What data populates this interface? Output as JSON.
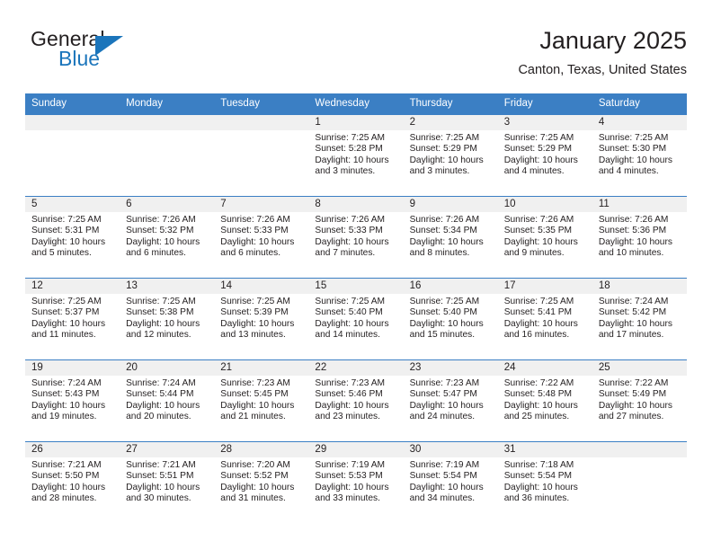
{
  "brand": {
    "name_top": "General",
    "name_bottom": "Blue",
    "color_primary": "#1b75bb",
    "color_text": "#231f20"
  },
  "header": {
    "title": "January 2025",
    "subtitle": "Canton, Texas, United States"
  },
  "theme": {
    "header_bg": "#3b7fc4",
    "header_text": "#ffffff",
    "daynum_bg": "#f0f0f0",
    "cell_bg": "#ffffff",
    "body_text": "#231f20"
  },
  "weekdays": [
    "Sunday",
    "Monday",
    "Tuesday",
    "Wednesday",
    "Thursday",
    "Friday",
    "Saturday"
  ],
  "labels": {
    "sunrise_prefix": "Sunrise: ",
    "sunset_prefix": "Sunset: ",
    "daylight_prefix": "Daylight: "
  },
  "weeks": [
    [
      {
        "day": "",
        "empty": true
      },
      {
        "day": "",
        "empty": true
      },
      {
        "day": "",
        "empty": true
      },
      {
        "day": "1",
        "sunrise": "Sunrise: 7:25 AM",
        "sunset": "Sunset: 5:28 PM",
        "daylight": "Daylight: 10 hours and 3 minutes."
      },
      {
        "day": "2",
        "sunrise": "Sunrise: 7:25 AM",
        "sunset": "Sunset: 5:29 PM",
        "daylight": "Daylight: 10 hours and 3 minutes."
      },
      {
        "day": "3",
        "sunrise": "Sunrise: 7:25 AM",
        "sunset": "Sunset: 5:29 PM",
        "daylight": "Daylight: 10 hours and 4 minutes."
      },
      {
        "day": "4",
        "sunrise": "Sunrise: 7:25 AM",
        "sunset": "Sunset: 5:30 PM",
        "daylight": "Daylight: 10 hours and 4 minutes."
      }
    ],
    [
      {
        "day": "5",
        "sunrise": "Sunrise: 7:25 AM",
        "sunset": "Sunset: 5:31 PM",
        "daylight": "Daylight: 10 hours and 5 minutes."
      },
      {
        "day": "6",
        "sunrise": "Sunrise: 7:26 AM",
        "sunset": "Sunset: 5:32 PM",
        "daylight": "Daylight: 10 hours and 6 minutes."
      },
      {
        "day": "7",
        "sunrise": "Sunrise: 7:26 AM",
        "sunset": "Sunset: 5:33 PM",
        "daylight": "Daylight: 10 hours and 6 minutes."
      },
      {
        "day": "8",
        "sunrise": "Sunrise: 7:26 AM",
        "sunset": "Sunset: 5:33 PM",
        "daylight": "Daylight: 10 hours and 7 minutes."
      },
      {
        "day": "9",
        "sunrise": "Sunrise: 7:26 AM",
        "sunset": "Sunset: 5:34 PM",
        "daylight": "Daylight: 10 hours and 8 minutes."
      },
      {
        "day": "10",
        "sunrise": "Sunrise: 7:26 AM",
        "sunset": "Sunset: 5:35 PM",
        "daylight": "Daylight: 10 hours and 9 minutes."
      },
      {
        "day": "11",
        "sunrise": "Sunrise: 7:26 AM",
        "sunset": "Sunset: 5:36 PM",
        "daylight": "Daylight: 10 hours and 10 minutes."
      }
    ],
    [
      {
        "day": "12",
        "sunrise": "Sunrise: 7:25 AM",
        "sunset": "Sunset: 5:37 PM",
        "daylight": "Daylight: 10 hours and 11 minutes."
      },
      {
        "day": "13",
        "sunrise": "Sunrise: 7:25 AM",
        "sunset": "Sunset: 5:38 PM",
        "daylight": "Daylight: 10 hours and 12 minutes."
      },
      {
        "day": "14",
        "sunrise": "Sunrise: 7:25 AM",
        "sunset": "Sunset: 5:39 PM",
        "daylight": "Daylight: 10 hours and 13 minutes."
      },
      {
        "day": "15",
        "sunrise": "Sunrise: 7:25 AM",
        "sunset": "Sunset: 5:40 PM",
        "daylight": "Daylight: 10 hours and 14 minutes."
      },
      {
        "day": "16",
        "sunrise": "Sunrise: 7:25 AM",
        "sunset": "Sunset: 5:40 PM",
        "daylight": "Daylight: 10 hours and 15 minutes."
      },
      {
        "day": "17",
        "sunrise": "Sunrise: 7:25 AM",
        "sunset": "Sunset: 5:41 PM",
        "daylight": "Daylight: 10 hours and 16 minutes."
      },
      {
        "day": "18",
        "sunrise": "Sunrise: 7:24 AM",
        "sunset": "Sunset: 5:42 PM",
        "daylight": "Daylight: 10 hours and 17 minutes."
      }
    ],
    [
      {
        "day": "19",
        "sunrise": "Sunrise: 7:24 AM",
        "sunset": "Sunset: 5:43 PM",
        "daylight": "Daylight: 10 hours and 19 minutes."
      },
      {
        "day": "20",
        "sunrise": "Sunrise: 7:24 AM",
        "sunset": "Sunset: 5:44 PM",
        "daylight": "Daylight: 10 hours and 20 minutes."
      },
      {
        "day": "21",
        "sunrise": "Sunrise: 7:23 AM",
        "sunset": "Sunset: 5:45 PM",
        "daylight": "Daylight: 10 hours and 21 minutes."
      },
      {
        "day": "22",
        "sunrise": "Sunrise: 7:23 AM",
        "sunset": "Sunset: 5:46 PM",
        "daylight": "Daylight: 10 hours and 23 minutes."
      },
      {
        "day": "23",
        "sunrise": "Sunrise: 7:23 AM",
        "sunset": "Sunset: 5:47 PM",
        "daylight": "Daylight: 10 hours and 24 minutes."
      },
      {
        "day": "24",
        "sunrise": "Sunrise: 7:22 AM",
        "sunset": "Sunset: 5:48 PM",
        "daylight": "Daylight: 10 hours and 25 minutes."
      },
      {
        "day": "25",
        "sunrise": "Sunrise: 7:22 AM",
        "sunset": "Sunset: 5:49 PM",
        "daylight": "Daylight: 10 hours and 27 minutes."
      }
    ],
    [
      {
        "day": "26",
        "sunrise": "Sunrise: 7:21 AM",
        "sunset": "Sunset: 5:50 PM",
        "daylight": "Daylight: 10 hours and 28 minutes."
      },
      {
        "day": "27",
        "sunrise": "Sunrise: 7:21 AM",
        "sunset": "Sunset: 5:51 PM",
        "daylight": "Daylight: 10 hours and 30 minutes."
      },
      {
        "day": "28",
        "sunrise": "Sunrise: 7:20 AM",
        "sunset": "Sunset: 5:52 PM",
        "daylight": "Daylight: 10 hours and 31 minutes."
      },
      {
        "day": "29",
        "sunrise": "Sunrise: 7:19 AM",
        "sunset": "Sunset: 5:53 PM",
        "daylight": "Daylight: 10 hours and 33 minutes."
      },
      {
        "day": "30",
        "sunrise": "Sunrise: 7:19 AM",
        "sunset": "Sunset: 5:54 PM",
        "daylight": "Daylight: 10 hours and 34 minutes."
      },
      {
        "day": "31",
        "sunrise": "Sunrise: 7:18 AM",
        "sunset": "Sunset: 5:54 PM",
        "daylight": "Daylight: 10 hours and 36 minutes."
      },
      {
        "day": "",
        "empty": true
      }
    ]
  ]
}
